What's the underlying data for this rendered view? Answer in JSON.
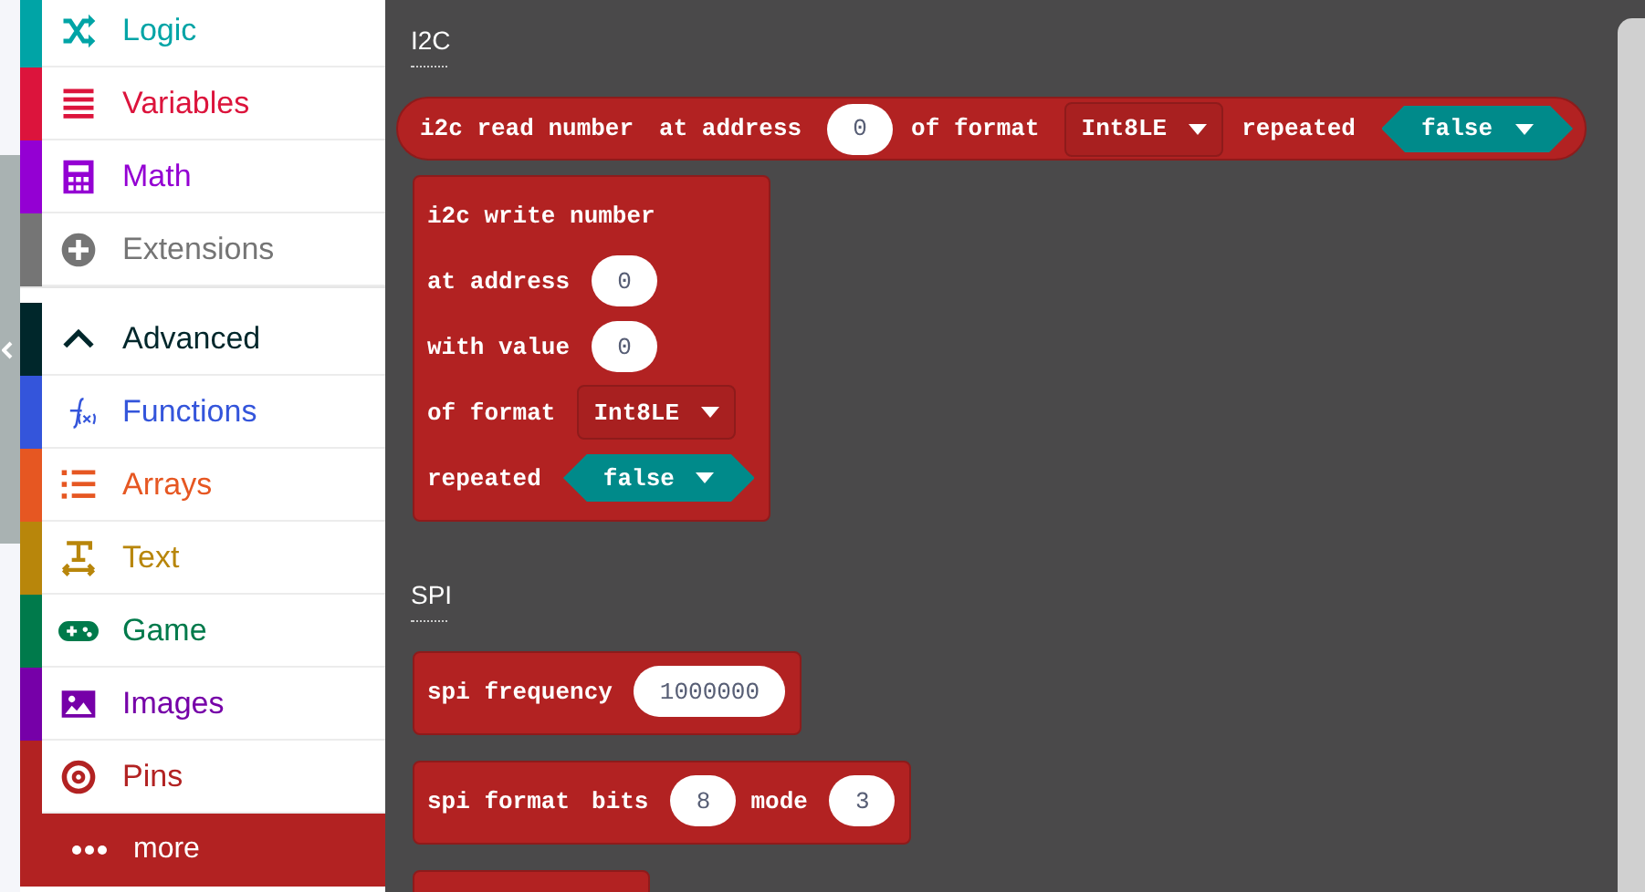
{
  "toolbox": {
    "groups": [
      {
        "items": [
          {
            "label": "Logic",
            "color": "#00a4a6",
            "selected": false
          },
          {
            "label": "Variables",
            "color": "#dc143c",
            "selected": false
          },
          {
            "label": "Math",
            "color": "#9400d3",
            "selected": false
          },
          {
            "label": "Extensions",
            "color": "#757575",
            "selected": false
          }
        ]
      },
      {
        "items": [
          {
            "label": "Advanced",
            "color": "#00272b",
            "selected": false
          },
          {
            "label": "Functions",
            "color": "#3455db",
            "selected": false
          },
          {
            "label": "Arrays",
            "color": "#e65722",
            "selected": false
          },
          {
            "label": "Text",
            "color": "#b8860b",
            "selected": false
          },
          {
            "label": "Game",
            "color": "#007a4b",
            "selected": false
          },
          {
            "label": "Images",
            "color": "#7600a8",
            "selected": false
          },
          {
            "label": "Pins",
            "color": "#b22222",
            "selected": false
          }
        ]
      }
    ],
    "more": {
      "label": "more",
      "selected": true
    }
  },
  "workspace": {
    "sections": [
      {
        "heading": "I2C",
        "blocks": [
          {
            "kind": "reporter",
            "rows": [
              [
                {
                  "kind": "label",
                  "text": "i2c read number"
                },
                {
                  "kind": "label",
                  "text": "at address"
                },
                {
                  "kind": "number",
                  "value": "0"
                },
                {
                  "kind": "label",
                  "text": "of format"
                },
                {
                  "kind": "dropdown",
                  "value": "Int8LE"
                },
                {
                  "kind": "label",
                  "text": "repeated"
                },
                {
                  "kind": "boolean",
                  "value": "false"
                }
              ]
            ]
          },
          {
            "kind": "statement",
            "rows": [
              [
                {
                  "kind": "label",
                  "text": "i2c write number"
                }
              ],
              [
                {
                  "kind": "label",
                  "text": "at address"
                },
                {
                  "kind": "number",
                  "value": "0"
                }
              ],
              [
                {
                  "kind": "label",
                  "text": "with value"
                },
                {
                  "kind": "number",
                  "value": "0"
                }
              ],
              [
                {
                  "kind": "label",
                  "text": "of format"
                },
                {
                  "kind": "dropdown",
                  "value": "Int8LE"
                }
              ],
              [
                {
                  "kind": "label",
                  "text": "repeated"
                },
                {
                  "kind": "boolean",
                  "value": "false"
                }
              ]
            ]
          }
        ]
      },
      {
        "heading": "SPI",
        "blocks": [
          {
            "kind": "statement",
            "rows": [
              [
                {
                  "kind": "label",
                  "text": "spi frequency"
                },
                {
                  "kind": "number",
                  "value": "1000000"
                }
              ]
            ]
          },
          {
            "kind": "statement",
            "rows": [
              [
                {
                  "kind": "label",
                  "text": "spi format"
                },
                {
                  "kind": "label",
                  "text": "bits"
                },
                {
                  "kind": "number",
                  "value": "8"
                },
                {
                  "kind": "label",
                  "text": "mode"
                },
                {
                  "kind": "number",
                  "value": "3"
                }
              ]
            ]
          },
          {
            "kind": "statement"
          }
        ]
      }
    ]
  }
}
